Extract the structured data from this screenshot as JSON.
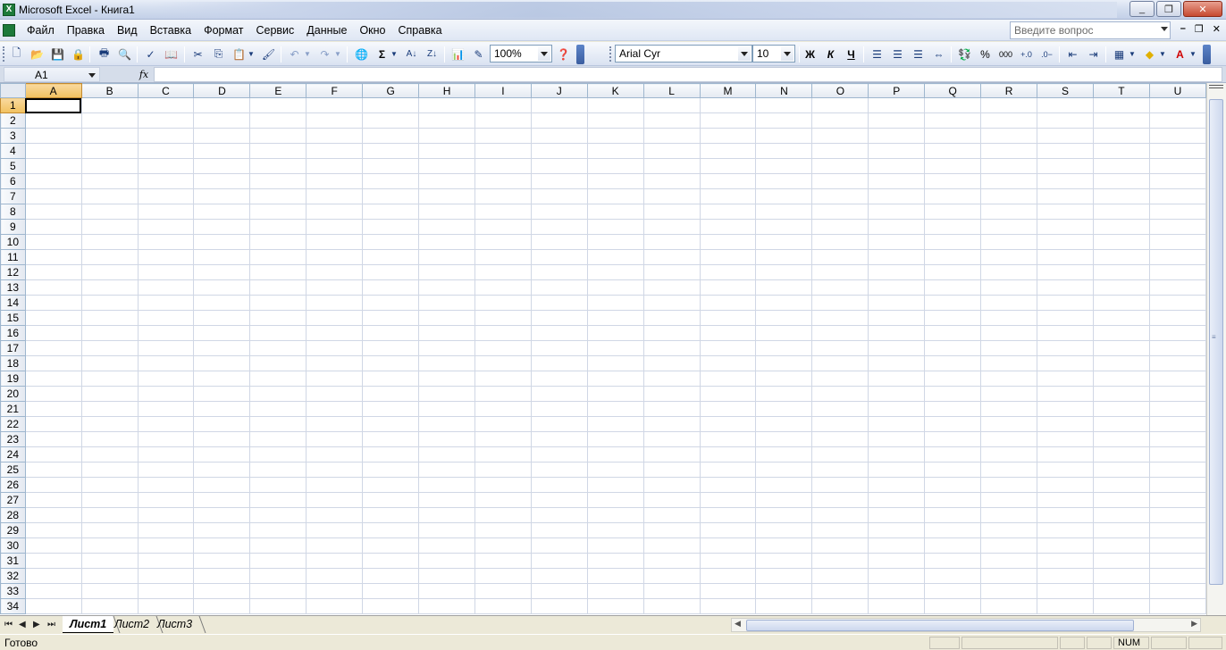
{
  "window": {
    "title": "Microsoft Excel - Книга1",
    "app_icon": "excel-icon"
  },
  "menu": {
    "items": [
      {
        "label": "Файл"
      },
      {
        "label": "Правка"
      },
      {
        "label": "Вид"
      },
      {
        "label": "Вставка"
      },
      {
        "label": "Формат"
      },
      {
        "label": "Сервис"
      },
      {
        "label": "Данные"
      },
      {
        "label": "Окно"
      },
      {
        "label": "Справка"
      }
    ],
    "help_placeholder": "Введите вопрос"
  },
  "toolbar": {
    "zoom": "100%",
    "font_name": "Arial Cyr",
    "font_size": "10",
    "bold_label": "Ж",
    "italic_label": "К",
    "underline_label": "Ч",
    "sum_label": "Σ",
    "percent_label": "%",
    "thousands_label": "000"
  },
  "formula_bar": {
    "name_box": "A1",
    "fx_label": "fx",
    "formula": ""
  },
  "sheet": {
    "columns": [
      "A",
      "B",
      "C",
      "D",
      "E",
      "F",
      "G",
      "H",
      "I",
      "J",
      "K",
      "L",
      "M",
      "N",
      "O",
      "P",
      "Q",
      "R",
      "S",
      "T",
      "U"
    ],
    "rows": [
      "1",
      "2",
      "3",
      "4",
      "5",
      "6",
      "7",
      "8",
      "9",
      "10",
      "11",
      "12",
      "13",
      "14",
      "15",
      "16",
      "17",
      "18",
      "19",
      "20",
      "21",
      "22",
      "23",
      "24",
      "25",
      "26",
      "27",
      "28",
      "29",
      "30",
      "31",
      "32",
      "33",
      "34"
    ],
    "active_cell": "A1"
  },
  "tabs": [
    {
      "label": "Лист1"
    },
    {
      "label": "Лист2"
    },
    {
      "label": "Лист3"
    }
  ],
  "status": {
    "text": "Готово",
    "num": "NUM"
  }
}
